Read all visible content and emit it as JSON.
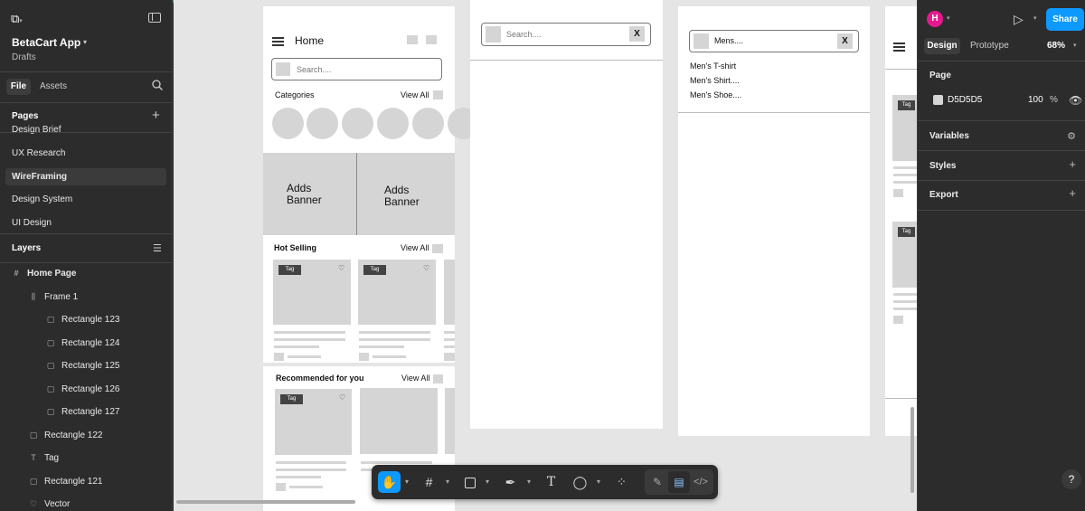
{
  "app": {
    "file_name": "BetaCart App",
    "location": "Drafts"
  },
  "left_tabs": {
    "file": "File",
    "assets": "Assets"
  },
  "pages": {
    "title": "Pages",
    "items": [
      "Design Brief",
      "UX Research",
      "WireFraming",
      "Design System",
      "UI Design"
    ],
    "selected": "WireFraming"
  },
  "layers": {
    "title": "Layers",
    "items": [
      {
        "name": "Home Page",
        "icon": "frame-icon",
        "indent": 0
      },
      {
        "name": "Frame 1",
        "icon": "auto-layout-icon",
        "indent": 1
      },
      {
        "name": "Rectangle 123",
        "icon": "rectangle-icon",
        "indent": 2
      },
      {
        "name": "Rectangle 124",
        "icon": "rectangle-icon",
        "indent": 2
      },
      {
        "name": "Rectangle 125",
        "icon": "rectangle-icon",
        "indent": 2
      },
      {
        "name": "Rectangle 126",
        "icon": "rectangle-icon",
        "indent": 2
      },
      {
        "name": "Rectangle 127",
        "icon": "rectangle-icon",
        "indent": 2
      },
      {
        "name": "Rectangle 122",
        "icon": "rectangle-icon",
        "indent": 1
      },
      {
        "name": "Tag",
        "icon": "text-icon",
        "indent": 1
      },
      {
        "name": "Rectangle 121",
        "icon": "rectangle-icon",
        "indent": 1
      },
      {
        "name": "Vector",
        "icon": "vector-icon",
        "indent": 1
      }
    ]
  },
  "wire_home": {
    "title": "Home",
    "search_placeholder": "Search....",
    "categories": "Categories",
    "view_all": "View All",
    "banner1": "Adds Banner",
    "banner2": "Adds Banner",
    "hot_selling": "Hot Selling",
    "recommended": "Recommended for you",
    "tag": "Tag"
  },
  "wire_search": {
    "placeholder": "Search....",
    "close": "X"
  },
  "wire_results": {
    "query": "Mens....",
    "close": "X",
    "results": [
      "Men's T-shirt",
      "Men's Shirt....",
      "Men's Shoe...."
    ]
  },
  "right": {
    "avatar_letter": "H",
    "share": "Share",
    "tab_design": "Design",
    "tab_prototype": "Prototype",
    "zoom": "68%",
    "page_section": "Page",
    "page_color": "D5D5D5",
    "page_opacity": "100",
    "opacity_unit": "%",
    "variables": "Variables",
    "styles": "Styles",
    "export": "Export"
  },
  "colors": {
    "accent": "#0d99ff",
    "canvas_bg": "#e5e5e5",
    "page_fill": "#D5D5D5",
    "panel_bg": "#2c2c2c"
  }
}
